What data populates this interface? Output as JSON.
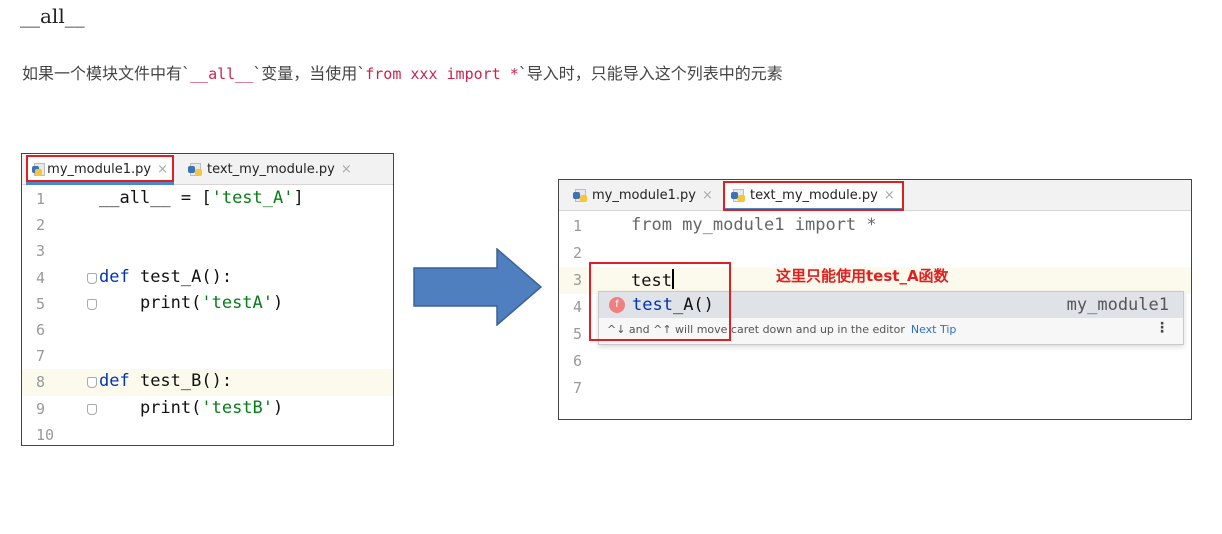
{
  "heading": "__all__",
  "description": {
    "part1": "如果一个模块文件中有`",
    "code1": "__all__",
    "part2": "`变量，当使用`",
    "code2": "from xxx import *",
    "part3": "`导入时，只能导入这个列表中的元素"
  },
  "left_editor": {
    "tabs": [
      {
        "label": "my_module1.py",
        "close": "×",
        "active": true
      },
      {
        "label": "text_my_module.py",
        "close": "×",
        "active": false
      }
    ],
    "lines": [
      {
        "num": "1",
        "tokens": [
          {
            "t": "__all__ = [",
            "c": ""
          },
          {
            "t": "'test_A'",
            "c": "str"
          },
          {
            "t": "]",
            "c": ""
          }
        ]
      },
      {
        "num": "2",
        "tokens": []
      },
      {
        "num": "3",
        "tokens": []
      },
      {
        "num": "4",
        "tokens": [
          {
            "t": "def ",
            "c": "kw"
          },
          {
            "t": "test_A():",
            "c": ""
          }
        ]
      },
      {
        "num": "5",
        "tokens": [
          {
            "t": "    print(",
            "c": ""
          },
          {
            "t": "'testA'",
            "c": "str"
          },
          {
            "t": ")",
            "c": ""
          }
        ]
      },
      {
        "num": "6",
        "tokens": []
      },
      {
        "num": "7",
        "tokens": []
      },
      {
        "num": "8",
        "tokens": [
          {
            "t": "def ",
            "c": "kw"
          },
          {
            "t": "test_B():",
            "c": ""
          }
        ]
      },
      {
        "num": "9",
        "tokens": [
          {
            "t": "    print(",
            "c": ""
          },
          {
            "t": "'testB'",
            "c": "str"
          },
          {
            "t": ")",
            "c": ""
          }
        ]
      },
      {
        "num": "10",
        "tokens": []
      }
    ]
  },
  "right_editor": {
    "tabs": [
      {
        "label": "my_module1.py",
        "close": "×",
        "active": false
      },
      {
        "label": "text_my_module.py",
        "close": "×",
        "active": true
      }
    ],
    "lines": [
      {
        "num": "1",
        "tokens": [
          {
            "t": "from my_module1 import *",
            "c": "dim"
          }
        ]
      },
      {
        "num": "2",
        "tokens": []
      },
      {
        "num": "3",
        "tokens": [
          {
            "t": "test",
            "c": ""
          }
        ]
      },
      {
        "num": "4",
        "tokens": []
      },
      {
        "num": "5",
        "tokens": []
      },
      {
        "num": "6",
        "tokens": []
      },
      {
        "num": "7",
        "tokens": []
      }
    ]
  },
  "completion": {
    "badge": "f",
    "match": "test",
    "rest": "_A()",
    "module": "my_module1",
    "tip": "^↓ and ^↑ will move caret down and up in the editor",
    "tip_link": "Next Tip",
    "menu": "⋮"
  },
  "annotation": "这里只能使用test_A函数",
  "icons": {
    "arrow": "arrow-right-icon",
    "python_file": "python-file-icon",
    "function": "function-icon"
  }
}
